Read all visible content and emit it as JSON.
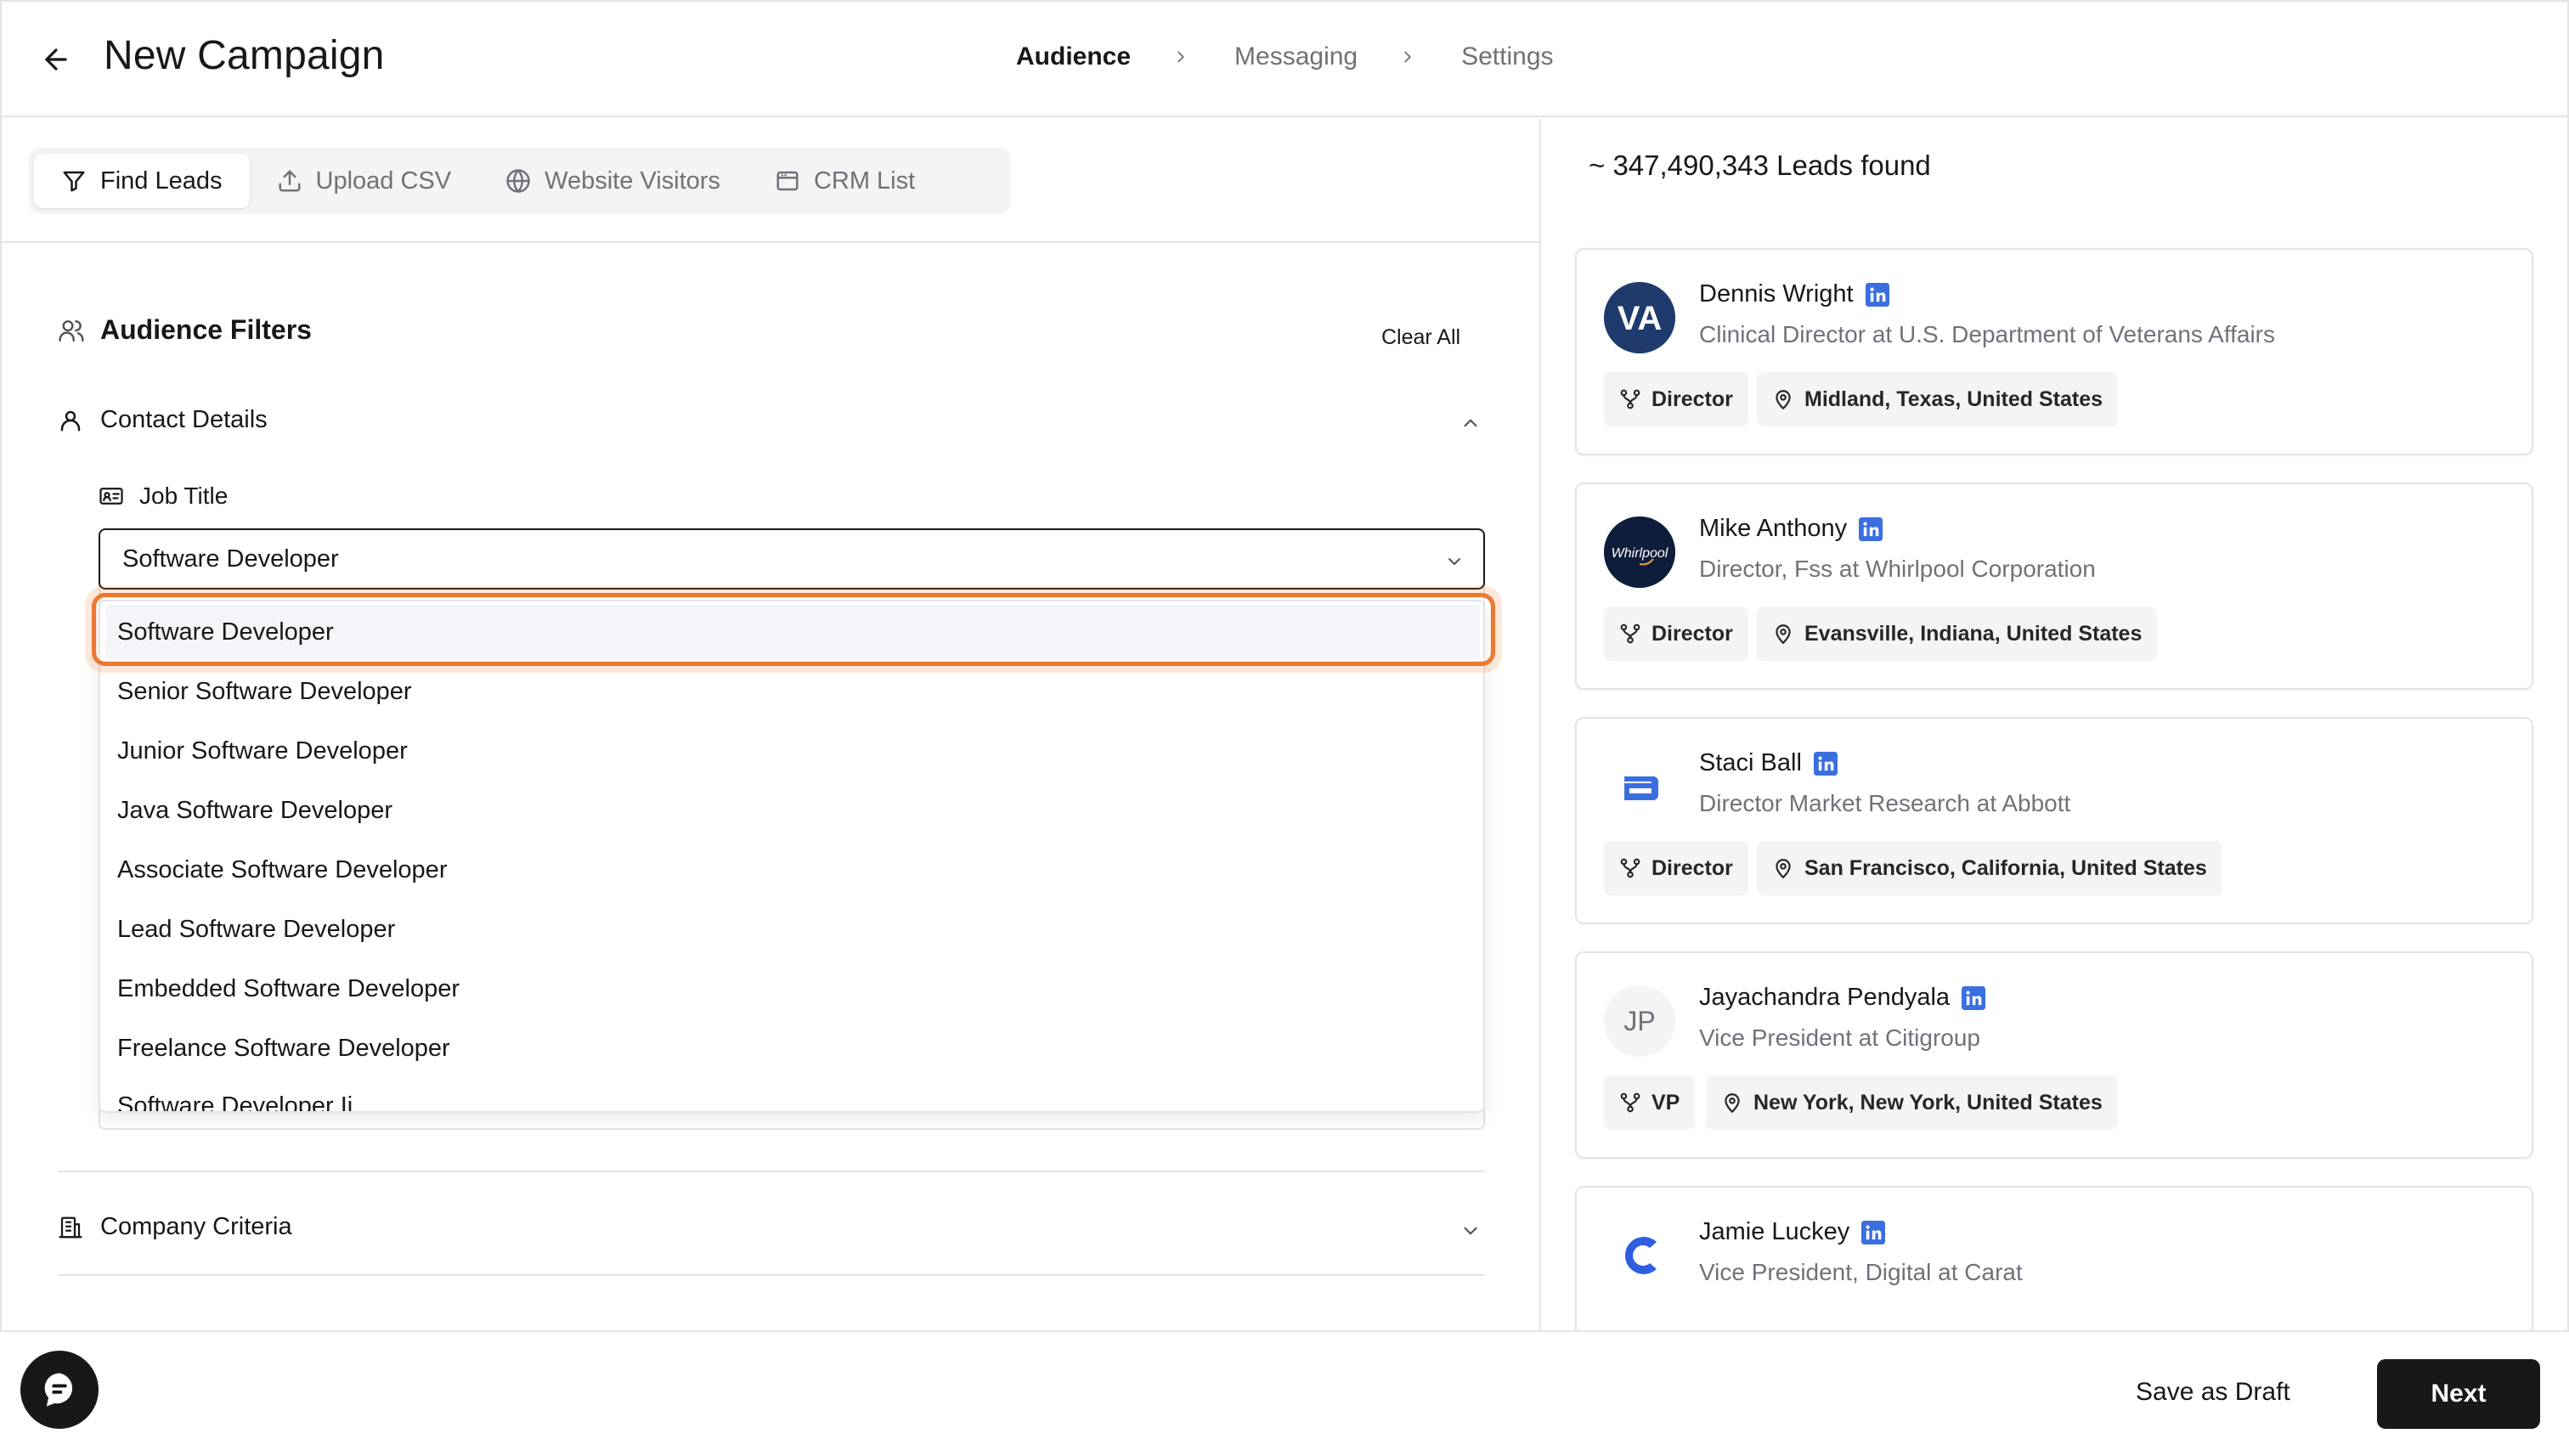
{
  "header": {
    "title": "New Campaign",
    "steps": [
      "Audience",
      "Messaging",
      "Settings"
    ]
  },
  "tabs": {
    "find_leads": "Find Leads",
    "upload_csv": "Upload CSV",
    "website_visitors": "Website Visitors",
    "crm_list": "CRM List"
  },
  "filters": {
    "title": "Audience Filters",
    "clear_all": "Clear All",
    "contact_details": "Contact Details",
    "job_title_label": "Job Title",
    "job_title_value": "Software Developer",
    "company_criteria": "Company Criteria",
    "options": [
      "Software Developer",
      "Senior Software Developer",
      "Junior Software Developer",
      "Java Software Developer",
      "Associate Software Developer",
      "Lead Software Developer",
      "Embedded Software Developer",
      "Freelance Software Developer",
      "Software Developer Ii"
    ]
  },
  "leads": {
    "count_text": "~ 347,490,343 Leads found",
    "items": [
      {
        "name": "Dennis Wright",
        "title": "Clinical Director at U.S. Department of Veterans Affairs",
        "seniority": "Director",
        "location": "Midland, Texas, United States",
        "avatar_text": "VA"
      },
      {
        "name": "Mike Anthony",
        "title": "Director, Fss at Whirlpool Corporation",
        "seniority": "Director",
        "location": "Evansville, Indiana, United States",
        "avatar_text": "Whirlpool"
      },
      {
        "name": "Staci Ball",
        "title": "Director Market Research at Abbott",
        "seniority": "Director",
        "location": "San Francisco, California, United States",
        "avatar_text": ""
      },
      {
        "name": "Jayachandra Pendyala",
        "title": "Vice President at Citigroup",
        "seniority": "VP",
        "location": "New York, New York, United States",
        "avatar_text": "JP"
      },
      {
        "name": "Jamie Luckey",
        "title": "Vice President, Digital at Carat",
        "seniority": "",
        "location": "",
        "avatar_text": ""
      }
    ]
  },
  "footer": {
    "save_draft": "Save as Draft",
    "next": "Next"
  },
  "colors": {
    "accent_ring": "#ea7a33",
    "linkedin": "#3b6fe0",
    "primary": "#18181b"
  }
}
